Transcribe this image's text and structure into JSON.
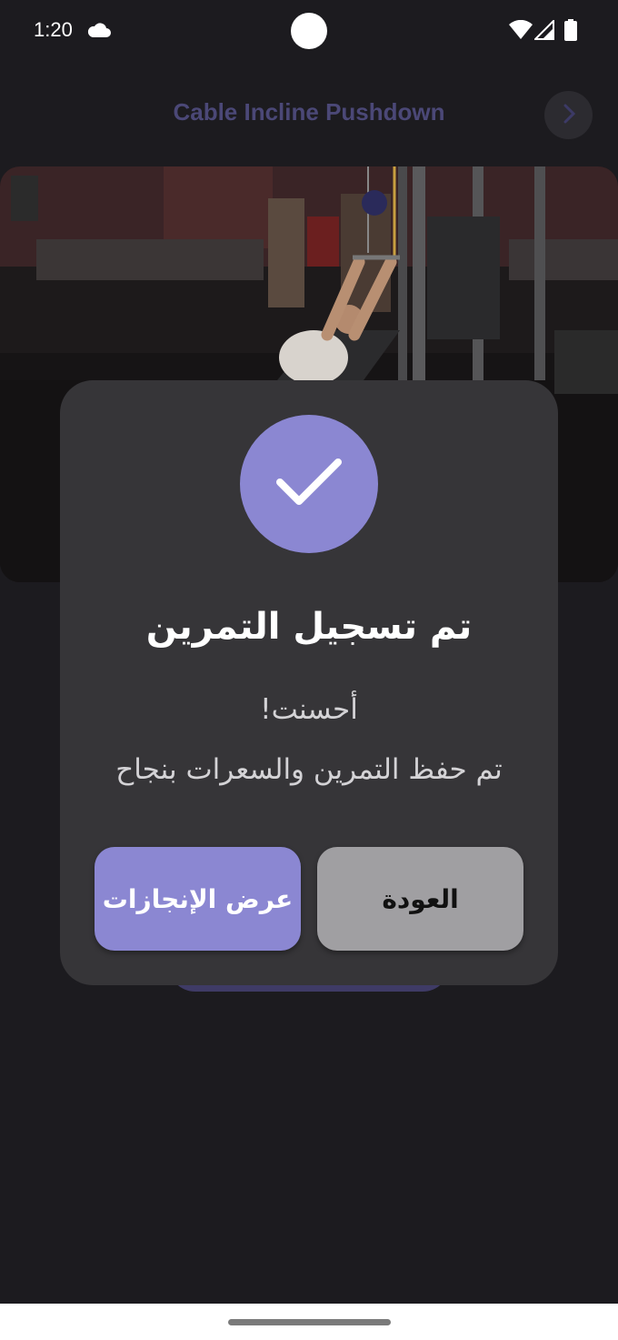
{
  "status_bar": {
    "time": "1:20"
  },
  "exercise": {
    "title": "Cable Incline Pushdown"
  },
  "dialog": {
    "title": "تم تسجيل التمرين",
    "line1": "أحسنت!",
    "line2": "تم حفظ التمرين والسعرات بنجاح",
    "achievements_button": "عرض الإنجازات",
    "back_button": "العودة"
  },
  "colors": {
    "background": "#1c1b1f",
    "dialog": "#363538",
    "accent": "#8b87d2",
    "secondary_button": "#a09fa2"
  },
  "icons": {
    "success": "check-icon",
    "next": "chevron-right-icon"
  }
}
